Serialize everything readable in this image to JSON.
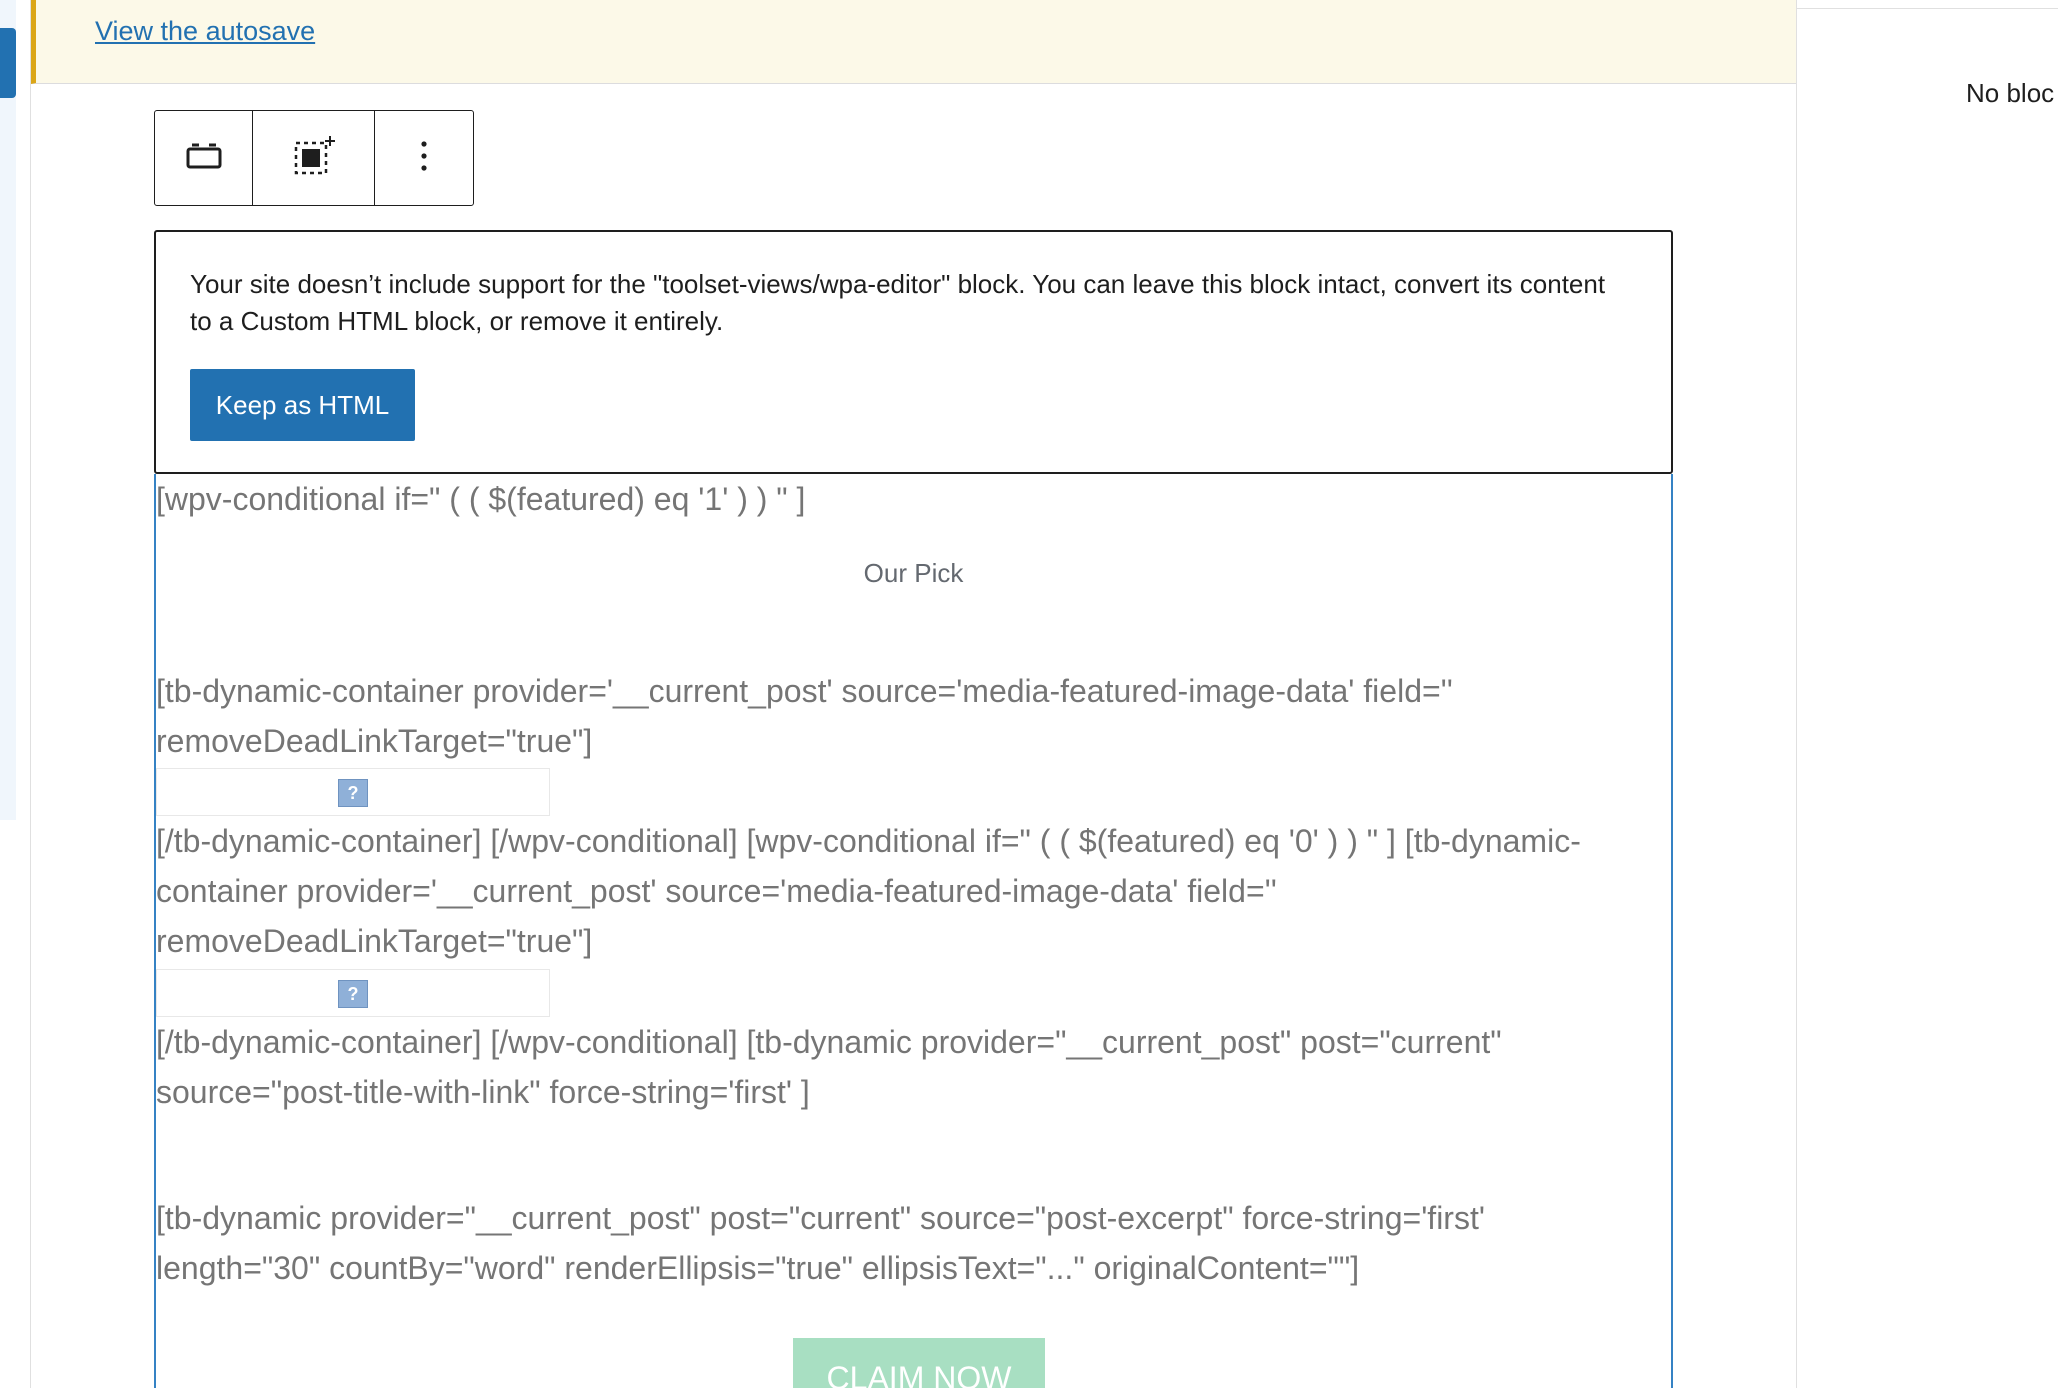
{
  "notice": {
    "link_text": "View the autosave"
  },
  "sidebar": {
    "partial_text": "No bloc"
  },
  "toolbar": {
    "buttons": [
      {
        "icon": "block-type-icon"
      },
      {
        "icon": "select-parent-icon"
      },
      {
        "icon": "more-options-icon",
        "glyph": "⋮"
      }
    ]
  },
  "warning": {
    "message": "Your site doesn’t include support for the \"toolset-views/wpa-editor\" block. You can leave this block intact, convert its content to a Custom HTML block, or remove it entirely.",
    "keep_button": "Keep as HTML"
  },
  "content": {
    "shortcode_1": "[wpv-conditional if=\" ( ( $(featured) eq '1' ) ) \" ]",
    "our_pick": "Our Pick",
    "shortcode_2": "[tb-dynamic-container provider='__current_post' source='media-featured-image-data' field='' removeDeadLinkTarget=\"true\"]",
    "image_placeholder": "?",
    "shortcode_3": "[/tb-dynamic-container] [/wpv-conditional] [wpv-conditional if=\" ( ( $(featured) eq '0' ) ) \" ] [tb-dynamic-container provider='__current_post' source='media-featured-image-data' field='' removeDeadLinkTarget=\"true\"]",
    "shortcode_4": "[/tb-dynamic-container] [/wpv-conditional] [tb-dynamic provider=\"__current_post\" post=\"current\" source=\"post-title-with-link\" force-string='first' ]",
    "shortcode_5": "[tb-dynamic provider=\"__current_post\" post=\"current\" source=\"post-excerpt\" force-string='first' length=\"30\" countBy=\"word\" renderEllipsis=\"true\" ellipsisText=\"...\" originalContent=\"\"]",
    "claim_button": "CLAIM NOW"
  },
  "colors": {
    "accent": "#2271b1",
    "notice_bg": "#fcf9e8",
    "notice_border": "#dba617",
    "claim_button": "#a8dfc2",
    "shortcode_text": "#757575"
  }
}
